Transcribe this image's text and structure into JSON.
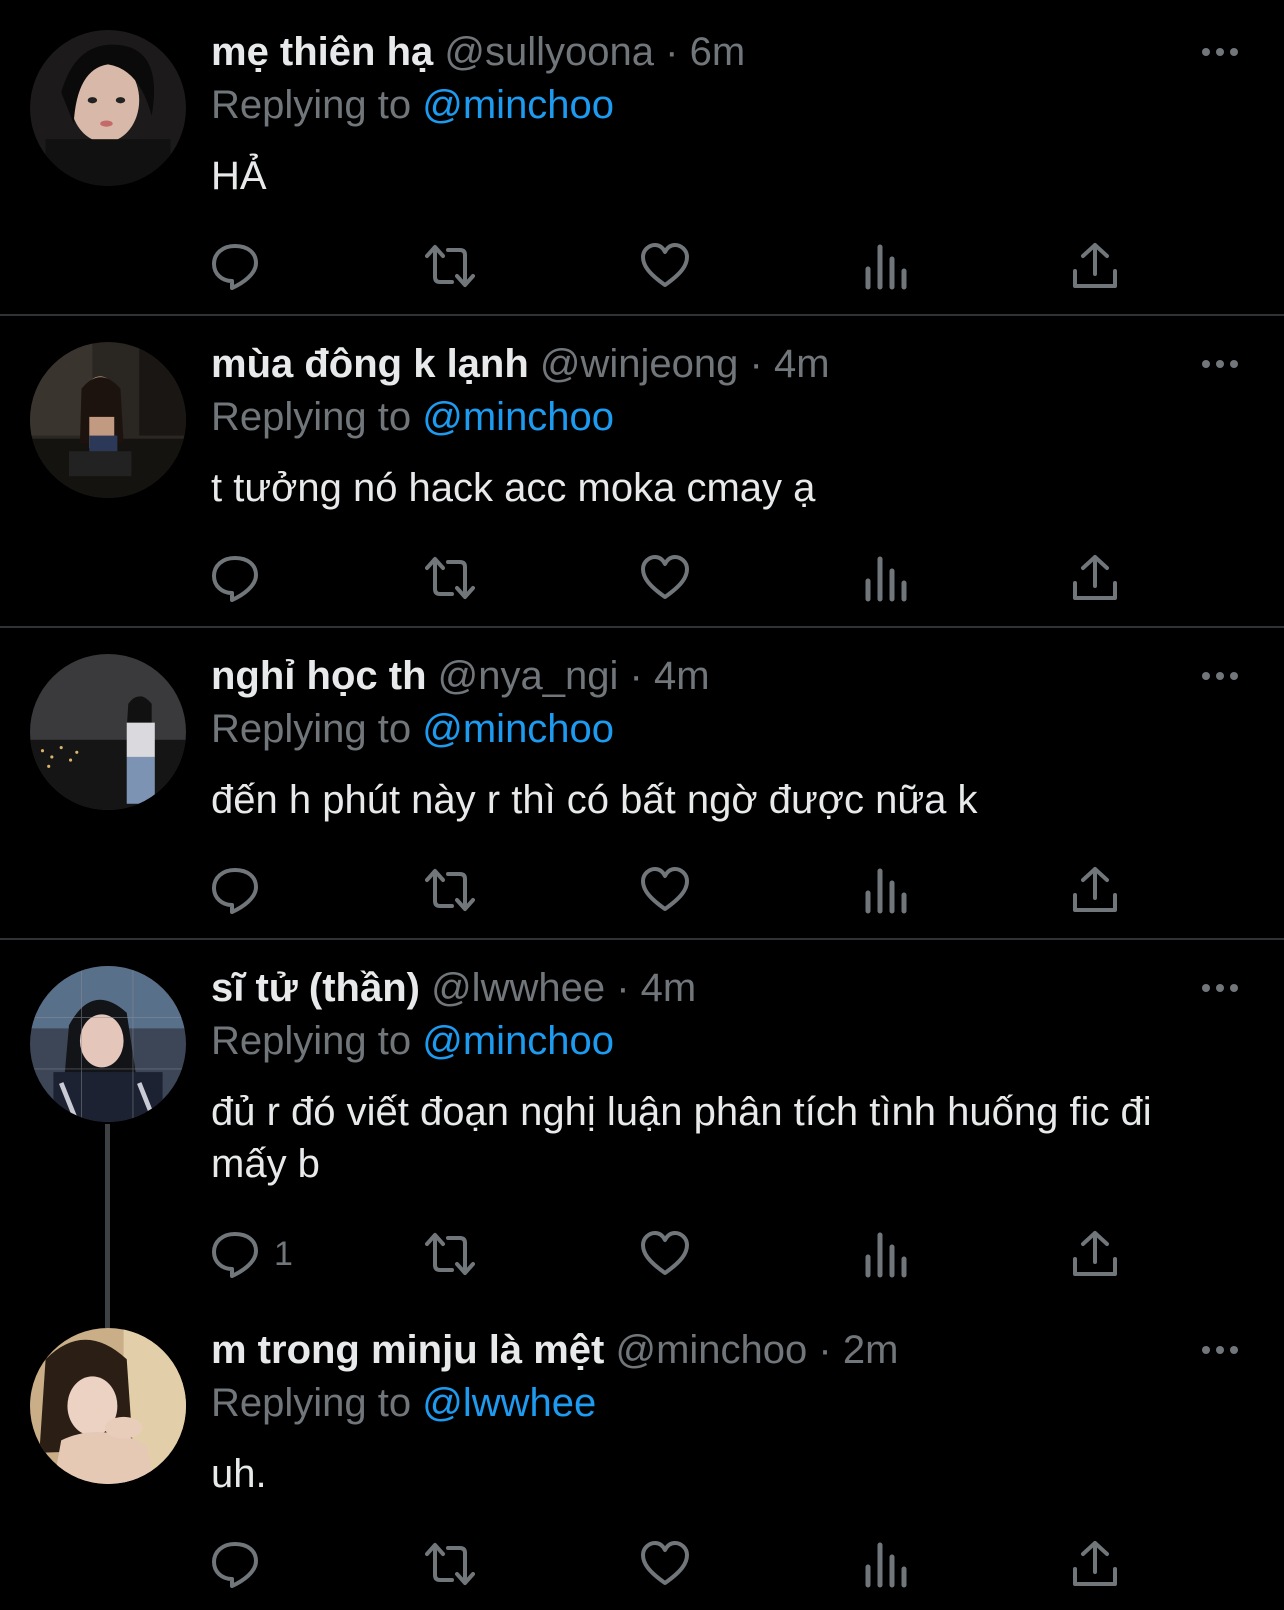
{
  "tweets": [
    {
      "name": "mẹ thiên hạ",
      "handle": "@sullyoona",
      "time": "6m",
      "replying_label": "Replying to",
      "replying_to": "@minchoo",
      "text": "HẢ",
      "reply_count": ""
    },
    {
      "name": "mùa đông k lạnh",
      "handle": "@winjeong",
      "time": "4m",
      "replying_label": "Replying to",
      "replying_to": "@minchoo",
      "text": "t tưởng nó hack acc moka cmay ạ",
      "reply_count": ""
    },
    {
      "name": "nghỉ học th",
      "handle": "@nya_ngi",
      "time": "4m",
      "replying_label": "Replying to",
      "replying_to": "@minchoo",
      "text": "đến h phút này r thì có bất ngờ được nữa k",
      "reply_count": ""
    },
    {
      "name": "sĩ tử (thần)",
      "handle": "@lwwhee",
      "time": "4m",
      "replying_label": "Replying to",
      "replying_to": "@minchoo",
      "text": "đủ r đó viết đoạn nghị luận phân tích tình huống fic đi mấy b",
      "reply_count": "1"
    },
    {
      "name": "m trong minju là mệt",
      "handle": "@minchoo",
      "time": "2m",
      "replying_label": "Replying to",
      "replying_to": "@lwwhee",
      "text": "uh.",
      "reply_count": ""
    }
  ],
  "separator": "·",
  "icons": [
    "more-icon",
    "reply-icon",
    "retweet-icon",
    "like-icon",
    "views-icon",
    "share-icon"
  ],
  "colors": {
    "background": "#000000",
    "text": "#e7e9ea",
    "muted": "#71767b",
    "link": "#1d9bf0",
    "divider": "#2f3336"
  }
}
